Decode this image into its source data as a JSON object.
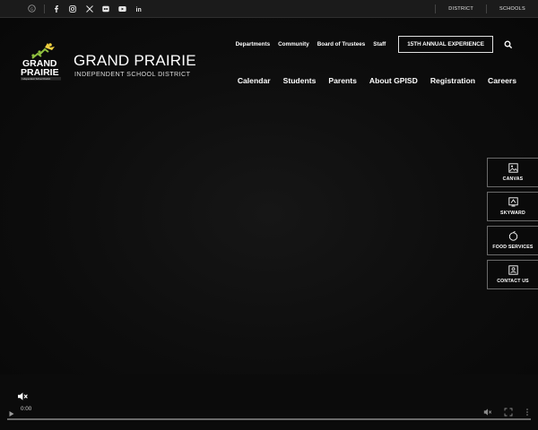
{
  "topbar": {
    "social_icons": [
      "translate-icon",
      "facebook-icon",
      "instagram-icon",
      "x-twitter-icon",
      "flickr-icon",
      "youtube-icon",
      "linkedin-icon"
    ],
    "district": "DISTRICT",
    "schools": "SCHOOLS"
  },
  "logo": {
    "mark_line1": "GRAND",
    "mark_line2": "PRAIRIE",
    "mark_tag": "Independent School District",
    "title": "GRAND PRAIRIE",
    "subtitle": "INDEPENDENT SCHOOL DISTRICT"
  },
  "utility_nav": [
    "Departments",
    "Community",
    "Board of Trustees",
    "Staff"
  ],
  "cta": "15TH ANNUAL EXPERIENCE",
  "main_nav": [
    "Calendar",
    "Students",
    "Parents",
    "About GPISD",
    "Registration",
    "Careers"
  ],
  "quick_links": [
    {
      "label": "CANVAS",
      "icon": "canvas-icon"
    },
    {
      "label": "SKYWARD",
      "icon": "skyward-icon"
    },
    {
      "label": "FOOD SERVICES",
      "icon": "food-services-icon"
    },
    {
      "label": "CONTACT US",
      "icon": "contact-icon"
    }
  ],
  "video": {
    "time": "0:00",
    "progress": 0,
    "muted": true
  },
  "colors": {
    "background": "#0b0b0b",
    "topbar": "#1b1b1b",
    "accent_star": "#f0d040",
    "accent_green": "#8fbf3f"
  }
}
